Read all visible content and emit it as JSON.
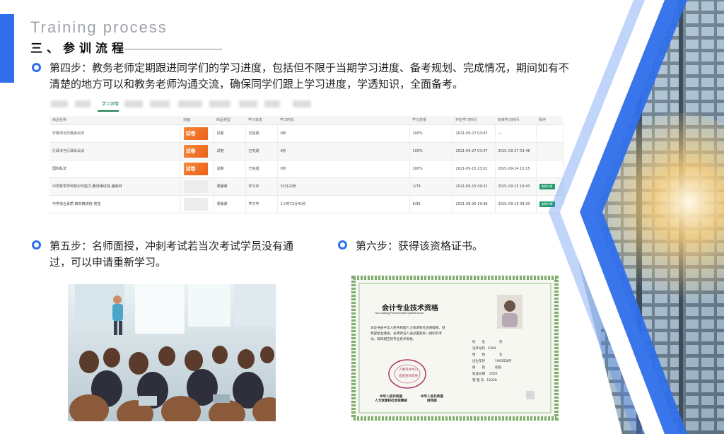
{
  "header": {
    "title_en": "Training process",
    "title_cn": "三、参训流程"
  },
  "steps": {
    "step4": "第四步：教务老师定期跟进同学们的学习进度，包括但不限于当期学习进度、备考规划、完成情况，期间如有不清楚的地方可以和教务老师沟通交流，确保同学们跟上学习进度，学透知识，全面备考。",
    "step5": "第五步：名师面授，冲刺考试若当次考试学员没有通过，可以申请重新学习。",
    "step6": "第六步：获得该资格证书。"
  },
  "table": {
    "active_tab": "学习详情",
    "columns": [
      "商品名称",
      "封面",
      "商品类型",
      "学习状态",
      "学习时长",
      "学习进度",
      "开始学习时间",
      "结束学习时间",
      "操作"
    ],
    "rows": [
      {
        "name": "行政法与行政诉讼法",
        "cover": "试卷",
        "type": "试卷",
        "status": "已完成",
        "duration": "0秒",
        "progress": "100%",
        "start": "2021-09-27 03:47",
        "end": "—",
        "action": ""
      },
      {
        "name": "行政法与行政诉讼法",
        "cover": "试卷",
        "type": "试卷",
        "status": "已完成",
        "duration": "0秒",
        "progress": "100%",
        "start": "2021-09-27 03:47",
        "end": "2021-09-27 03:48",
        "action": ""
      },
      {
        "name": "国际私法",
        "cover": "试卷",
        "type": "试卷",
        "status": "已完成",
        "duration": "0秒",
        "progress": "100%",
        "start": "2021-09-15 23:02",
        "end": "2021-09-24 15:15",
        "action": ""
      },
      {
        "name": "中学数学学科知识与能力-教材精讲班-魔晓林",
        "cover": "",
        "type": "录播课",
        "status": "学习中",
        "duration": "32分22秒",
        "progress": "1/79",
        "start": "2021-09-15 09:31",
        "end": "2021-09-15 19:43",
        "action": "查看详情"
      },
      {
        "name": "中学综合素质-教材精讲班-苑龙",
        "cover": "",
        "type": "录播课",
        "status": "学习中",
        "duration": "1小时13分41秒",
        "progress": "6/96",
        "start": "2021-08-26 19:48",
        "end": "2021-09-15 09:33",
        "action": "查看详情"
      }
    ]
  },
  "certificate": {
    "title_cn": "会计专业技术资格",
    "title_en": "Accounting Professional Qualification",
    "body": "本证书由中华人民共和国人力资源和社会保障部、财政部批准颁发，表明持证人通过国家统一组织的考试，取得相应的专业技术资格。",
    "fields": [
      {
        "label": "姓　　名",
        "value": "孙"
      },
      {
        "label": "证件号码",
        "value": "4304"
      },
      {
        "label": "性　　别",
        "value": "女"
      },
      {
        "label": "出生年月",
        "value": "1993年8月"
      },
      {
        "label": "级　　别",
        "value": "初级"
      },
      {
        "label": "批准日期",
        "value": "2020"
      },
      {
        "label": "管 理 号",
        "value": "12028"
      }
    ],
    "seal_text": "人事考试中心",
    "seal_sub": "成绩查询结果",
    "issuer_left": "中华人民共和国\n人力资源和社会保障部",
    "issuer_right": "中华人民共和国\n财政部"
  },
  "colors": {
    "accent": "#2f6fea",
    "green_button": "#1e9a6a",
    "cert_border": "#7fae6e",
    "title_gray": "#9ea3a9"
  }
}
